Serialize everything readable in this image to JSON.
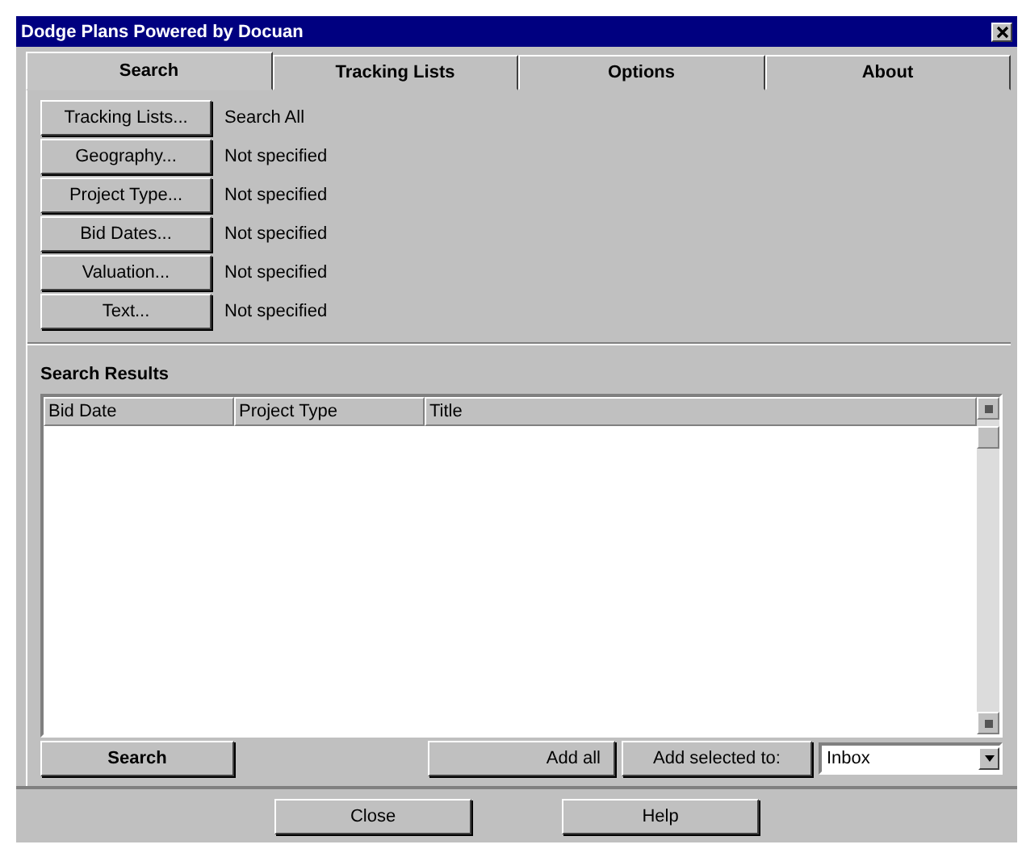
{
  "window": {
    "title": "Dodge Plans Powered by Docuan"
  },
  "tabs": [
    {
      "label": "Search",
      "selected": true
    },
    {
      "label": "Tracking Lists",
      "selected": false
    },
    {
      "label": "Options",
      "selected": false
    },
    {
      "label": "About",
      "selected": false
    }
  ],
  "criteria": [
    {
      "button": "Tracking Lists...",
      "value": "Search All"
    },
    {
      "button": "Geography...",
      "value": "Not specified"
    },
    {
      "button": "Project Type...",
      "value": "Not specified"
    },
    {
      "button": "Bid Dates...",
      "value": "Not specified"
    },
    {
      "button": "Valuation...",
      "value": "Not specified"
    },
    {
      "button": "Text...",
      "value": "Not specified"
    }
  ],
  "results": {
    "heading": "Search Results",
    "columns": [
      "Bid Date",
      "Project Type",
      "Title"
    ]
  },
  "actions": {
    "search": "Search",
    "add_all": "Add all",
    "add_selected": "Add selected to:",
    "destination": "Inbox"
  },
  "buttons": [
    "Close",
    "Help"
  ]
}
